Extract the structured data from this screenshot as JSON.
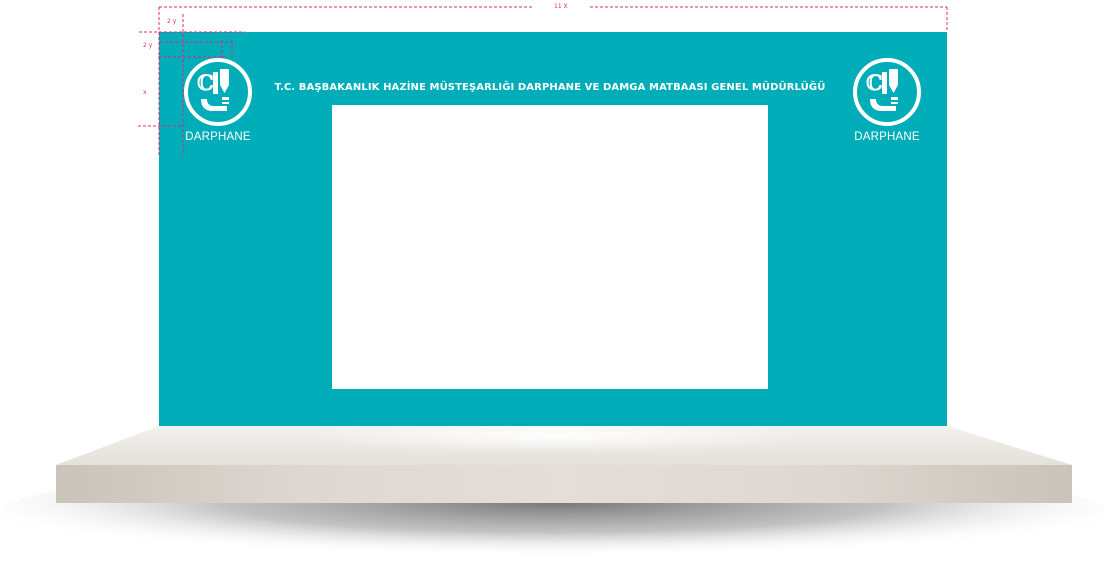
{
  "header": {
    "title": "T.C. BAŞBAKANLIK HAZİNE MÜSTEŞARLIĞI DARPHANE VE DAMGA MATBAASI GENEL MÜDÜRLÜĞÜ"
  },
  "logo_left": {
    "wordmark": "DARPHANE",
    "icon": "darphane-emblem-icon"
  },
  "logo_right": {
    "wordmark": "DARPHANE",
    "icon": "darphane-emblem-icon"
  },
  "dimensions": {
    "width_label": "11 X",
    "margin_top_label": "2 y",
    "margin_side_label": "2 y",
    "logo_height_label": "x"
  },
  "colors": {
    "backdrop": "#00adb8",
    "screen": "#ffffff",
    "guides": "#e0287c",
    "stage_top": "#e9e6e1",
    "stage_front": "#d5d0c8"
  }
}
